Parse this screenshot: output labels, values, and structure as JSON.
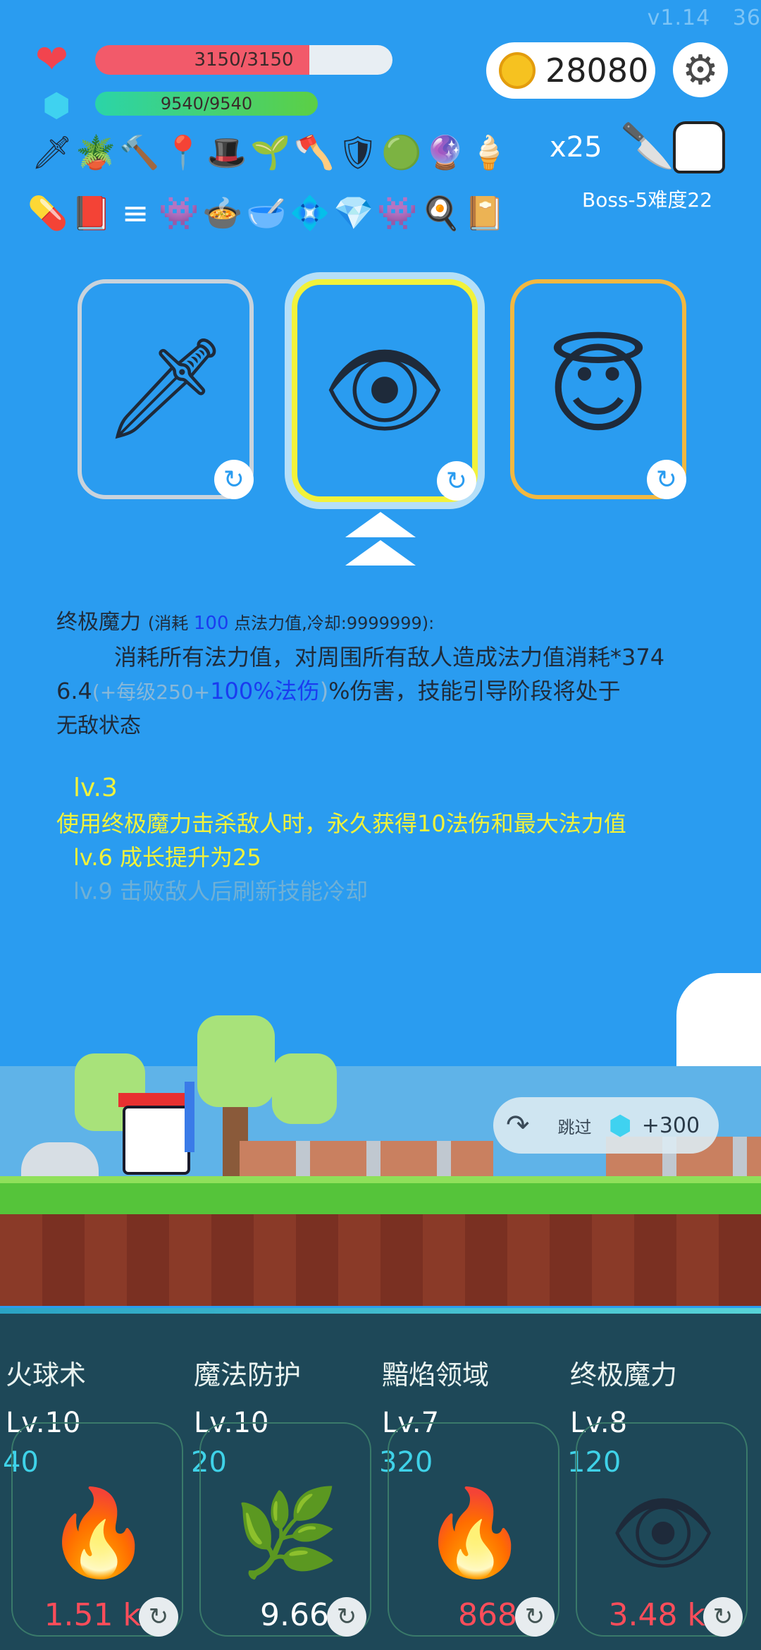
{
  "version": "v1.14",
  "corner_num": "36",
  "stats": {
    "hp": "3150/3150",
    "hp_fraction": 1.0,
    "mp": "9540/9540",
    "mp_fraction": 1.0
  },
  "coins": "28080",
  "icon_row1": [
    "sword-icon",
    "potted-plant-icon",
    "hammer-icon",
    "map-pin-icon",
    "wizard-hat-icon",
    "sapling-icon",
    "axe-icon",
    "shield-icon",
    "green-orb-pet-icon",
    "crystal-ball-icon",
    "ice-cream-icon"
  ],
  "icon_row1_glyphs": [
    "🗡",
    "🪴",
    "🔨",
    "📍",
    "🎩",
    "🌱",
    "🪓",
    "🛡",
    "🟢",
    "🔮",
    "🍦"
  ],
  "stack_count": "x25",
  "icon_row2_glyphs": [
    "💊",
    "📕",
    "≡",
    "👾",
    "🍲",
    "🥣",
    "💠",
    "💎",
    "👾",
    "🍳",
    "📔"
  ],
  "boss_label": "Boss-5难度22",
  "cards": [
    {
      "glyph": "🗡"
    },
    {
      "glyph": "👁"
    },
    {
      "glyph": "😇"
    }
  ],
  "skill_desc": {
    "title": "终极魔力",
    "meta_prefix": "(消耗 ",
    "meta_cost": "100",
    "meta_suffix": " 点法力值,冷却:9999999):",
    "line1": "消耗所有法力值，对周围所有敌人造成法力值消耗*374",
    "line2_a": "6.4",
    "line2_b": "(+每级250+",
    "line2_c": "100%法伤",
    "line2_d": ")",
    "line2_e": "%伤害，技能引导阶段将处于",
    "line3": "无敌状态"
  },
  "levels": {
    "lv3_title": "lv.3",
    "lv3_text": "使用终极魔力击杀敌人时，永久获得10法伤和最大法力值",
    "lv6": "lv.6 成长提升为25",
    "lv9": "lv.9 击败敌人后刷新技能冷却"
  },
  "skip": {
    "label": "跳过",
    "reward": "+300"
  },
  "skills": [
    {
      "name": "火球术",
      "lv": "Lv.10",
      "cost": "40",
      "value": "1.51 k",
      "value_color": "#ff4d5a",
      "glyph": "🔥"
    },
    {
      "name": "魔法防护",
      "lv": "Lv.10",
      "cost": "20",
      "value": "9.66",
      "value_color": "#ffffff",
      "glyph": "🌿"
    },
    {
      "name": "黯焰领域",
      "lv": "Lv.7",
      "cost": "320",
      "value": "868",
      "value_color": "#ff4d5a",
      "glyph": "🔥"
    },
    {
      "name": "终极魔力",
      "lv": "Lv.8",
      "cost": "120",
      "value": "3.48 k",
      "value_color": "#ff4d5a",
      "glyph": "👁"
    }
  ],
  "colors": {
    "hp": "#f25a6a",
    "mp_start": "#2bd4a8",
    "mp_end": "#5ccf45",
    "highlight": "#f2f23a"
  }
}
